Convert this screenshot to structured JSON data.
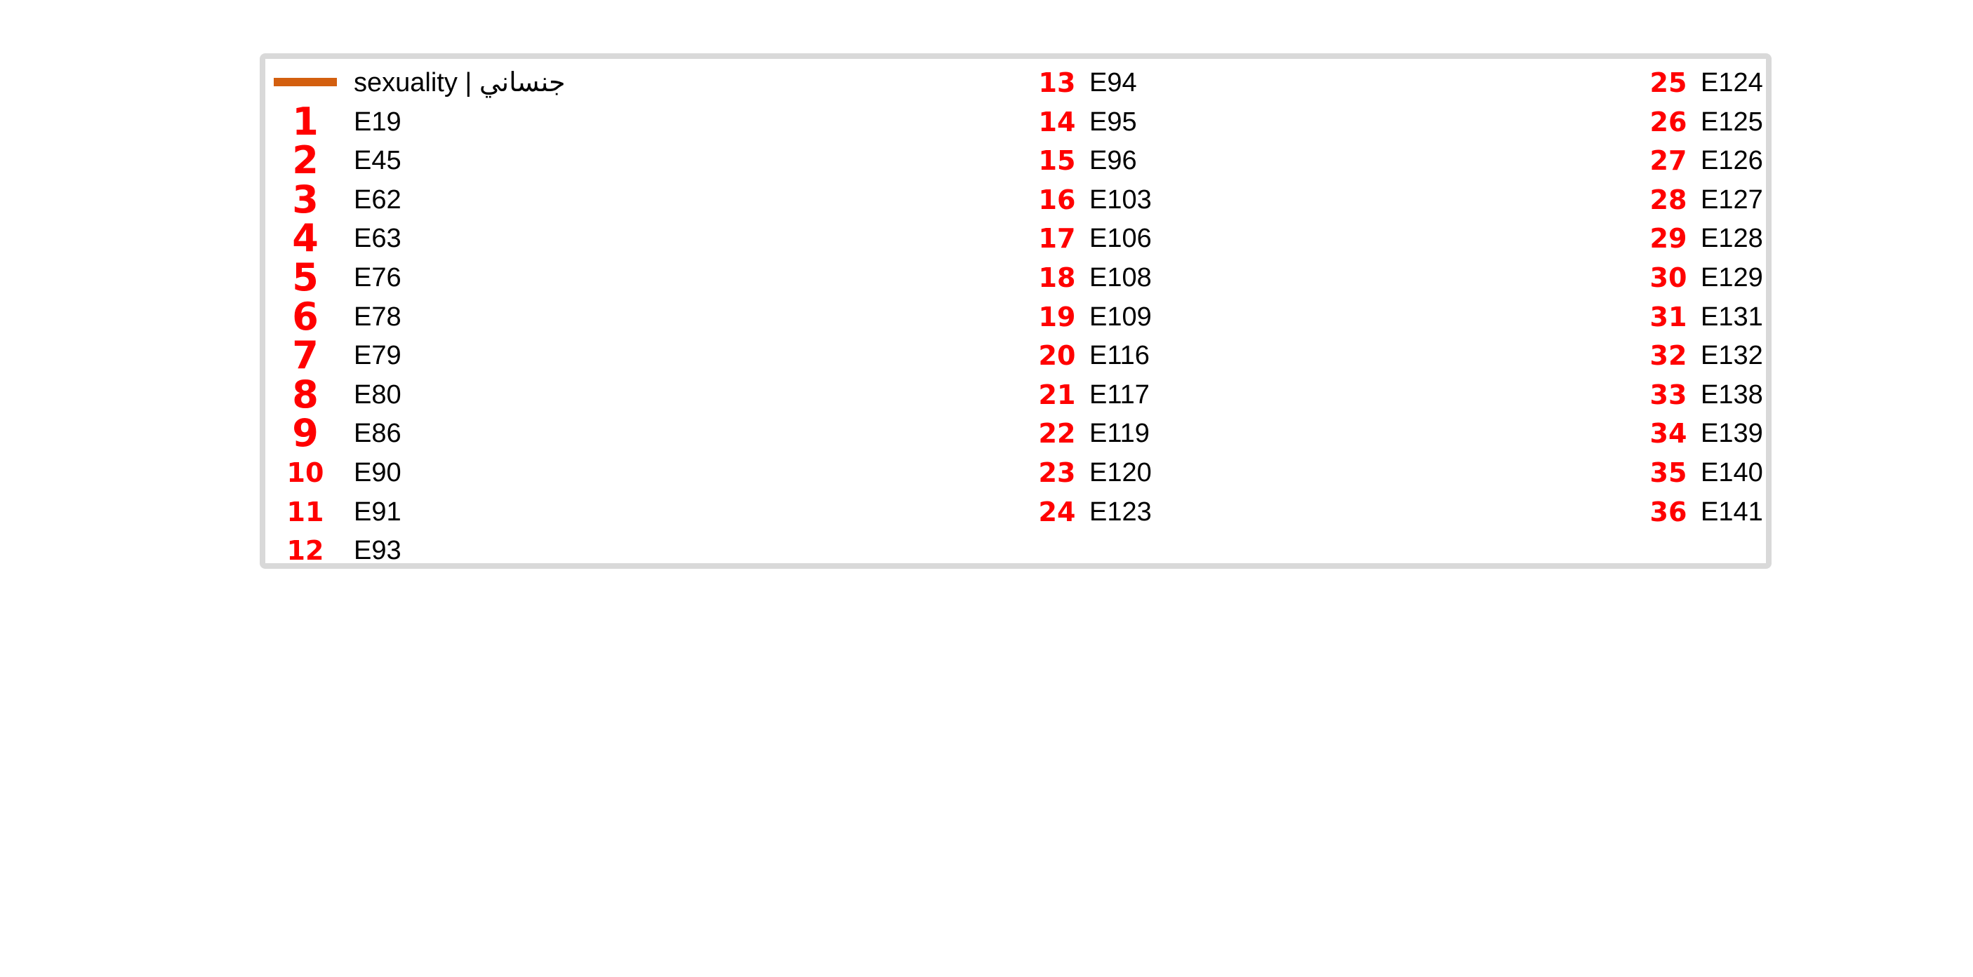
{
  "legend": {
    "title": "sexuality | جنساني",
    "swatch_color": "#d35f0f",
    "number_color": "#ff0000",
    "border_color": "#d9d9d9",
    "entries": [
      {
        "num": "1",
        "code": "E19"
      },
      {
        "num": "2",
        "code": "E45"
      },
      {
        "num": "3",
        "code": "E62"
      },
      {
        "num": "4",
        "code": "E63"
      },
      {
        "num": "5",
        "code": "E76"
      },
      {
        "num": "6",
        "code": "E78"
      },
      {
        "num": "7",
        "code": "E79"
      },
      {
        "num": "8",
        "code": "E80"
      },
      {
        "num": "9",
        "code": "E86"
      },
      {
        "num": "10",
        "code": "E90"
      },
      {
        "num": "11",
        "code": "E91"
      },
      {
        "num": "12",
        "code": "E93"
      },
      {
        "num": "13",
        "code": "E94"
      },
      {
        "num": "14",
        "code": "E95"
      },
      {
        "num": "15",
        "code": "E96"
      },
      {
        "num": "16",
        "code": "E103"
      },
      {
        "num": "17",
        "code": "E106"
      },
      {
        "num": "18",
        "code": "E108"
      },
      {
        "num": "19",
        "code": "E109"
      },
      {
        "num": "20",
        "code": "E116"
      },
      {
        "num": "21",
        "code": "E117"
      },
      {
        "num": "22",
        "code": "E119"
      },
      {
        "num": "23",
        "code": "E120"
      },
      {
        "num": "24",
        "code": "E123"
      },
      {
        "num": "25",
        "code": "E124"
      },
      {
        "num": "26",
        "code": "E125"
      },
      {
        "num": "27",
        "code": "E126"
      },
      {
        "num": "28",
        "code": "E127"
      },
      {
        "num": "29",
        "code": "E128"
      },
      {
        "num": "30",
        "code": "E129"
      },
      {
        "num": "31",
        "code": "E131"
      },
      {
        "num": "32",
        "code": "E132"
      },
      {
        "num": "33",
        "code": "E138"
      },
      {
        "num": "34",
        "code": "E139"
      },
      {
        "num": "35",
        "code": "E140"
      },
      {
        "num": "36",
        "code": "E141"
      }
    ]
  }
}
